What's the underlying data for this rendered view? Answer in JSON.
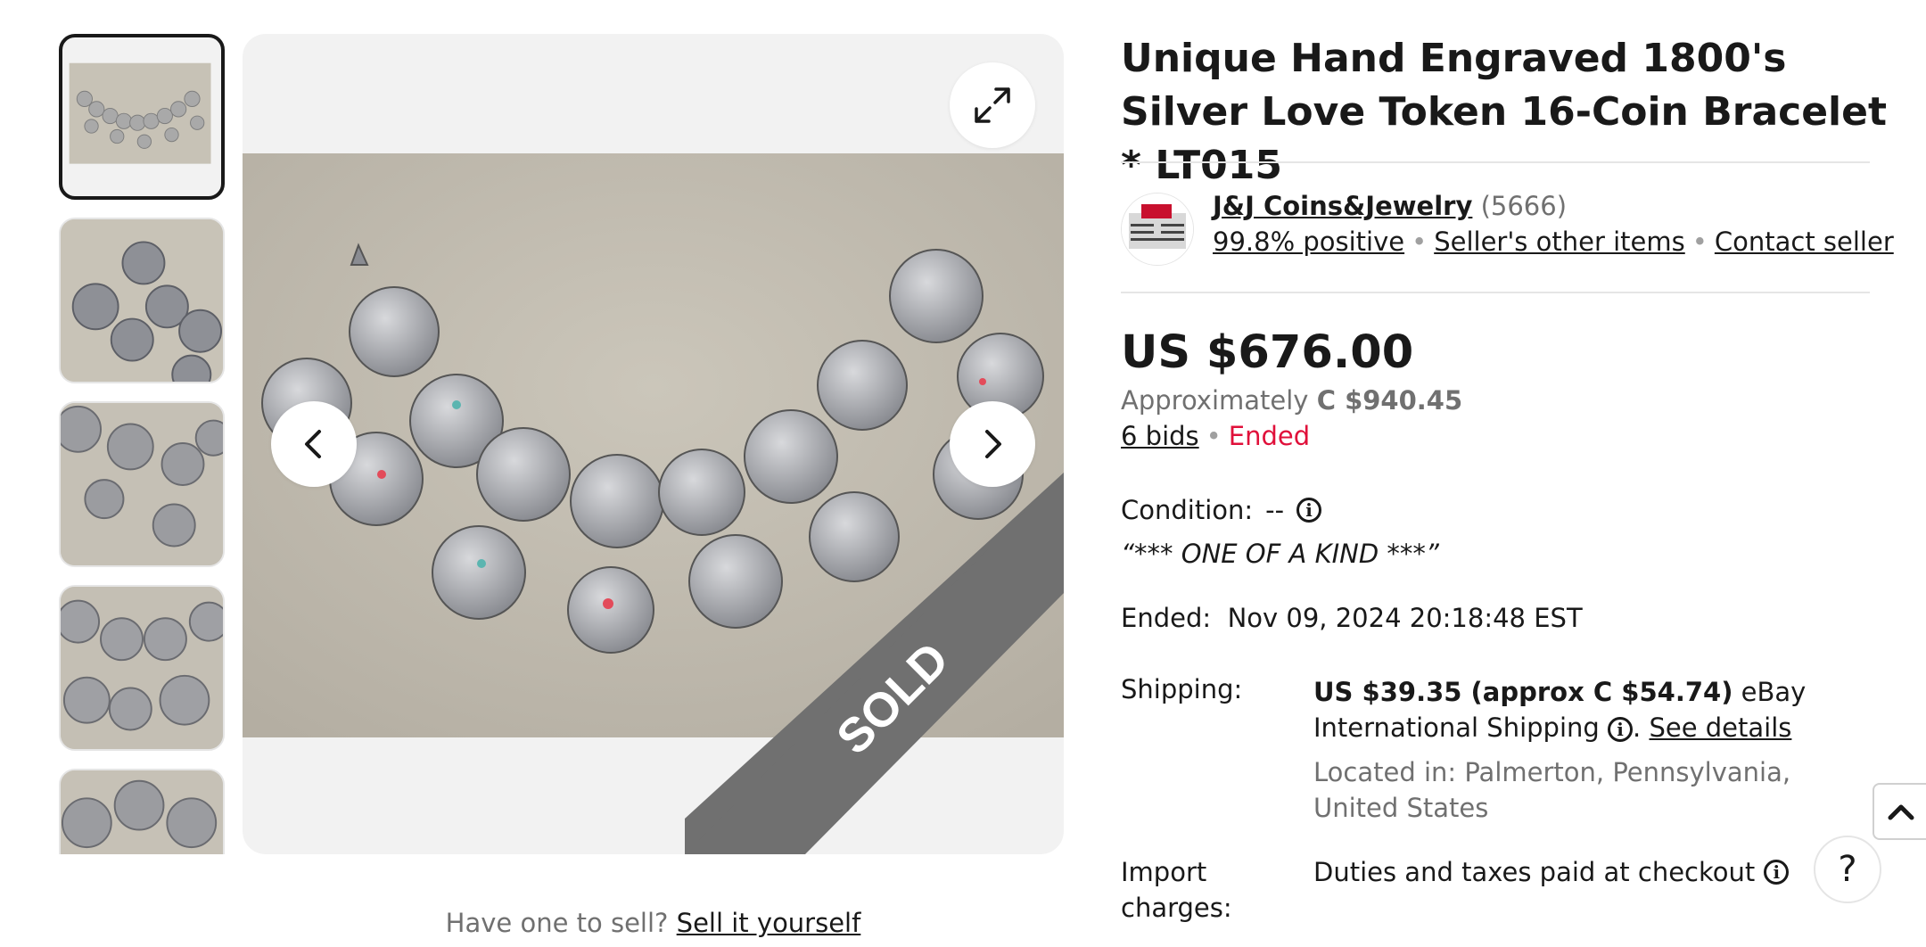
{
  "listing": {
    "title": "Unique Hand Engraved 1800's Silver Love Token 16-Coin Bracelet * LT015"
  },
  "gallery": {
    "sold_label": "SOLD",
    "thumbnail_count_visible": 5,
    "sell_prompt": "Have one to sell?",
    "sell_link": "Sell it yourself"
  },
  "seller": {
    "name": "J&J Coins&Jewelry",
    "feedback_count": "(5666)",
    "positive": "99.8% positive",
    "other_items": "Seller's other items",
    "contact": "Contact seller"
  },
  "price": {
    "main": "US $676.00",
    "approx_label": "Approximately",
    "approx_value": "C $940.45",
    "bids": "6 bids",
    "status": "Ended"
  },
  "details": {
    "condition_label": "Condition:",
    "condition_value": "--",
    "condition_note": "“*** ONE OF A KIND ***”",
    "ended_label": "Ended:",
    "ended_value": "Nov 09, 2024 20:18:48 EST",
    "shipping_label": "Shipping:",
    "shipping_price": "US $39.35 (approx C $54.74)",
    "shipping_service": "eBay International Shipping",
    "shipping_details_link": "See details",
    "location": "Located in: Palmerton, Pennsylvania, United States",
    "import_label": "Import charges:",
    "import_value": "Duties and taxes paid at checkout"
  },
  "help_glyph": "?",
  "colors": {
    "text": "#191919",
    "muted": "#707070",
    "ended_red": "#e0103a",
    "viewer_bg": "#f2f2f2",
    "sold_band": "#707070"
  }
}
